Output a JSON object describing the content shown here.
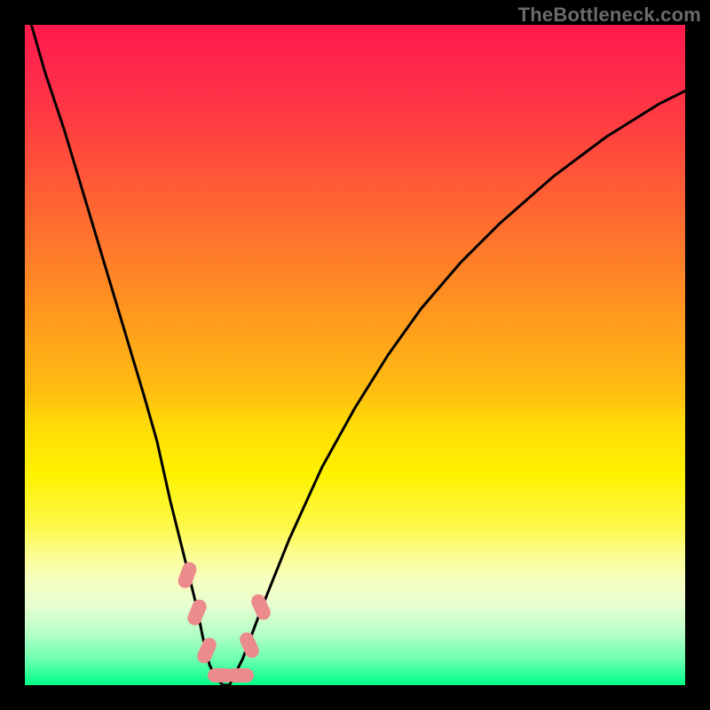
{
  "watermark": "TheBottleneck.com",
  "colors": {
    "frame": "#000000",
    "curve": "#000000",
    "marker": "#ec8b8b"
  },
  "chart_data": {
    "type": "line",
    "title": "",
    "xlabel": "",
    "ylabel": "",
    "xlim": [
      0,
      100
    ],
    "ylim": [
      0,
      100
    ],
    "series": [
      {
        "name": "bottleneck-curve",
        "x": [
          1,
          3,
          6,
          9,
          12,
          15,
          18,
          20,
          22,
          24,
          26,
          27,
          28,
          29,
          30,
          31,
          33,
          36,
          40,
          45,
          50,
          55,
          60,
          66,
          72,
          80,
          88,
          96,
          100
        ],
        "y": [
          100,
          93,
          84,
          74,
          64,
          54,
          44,
          37,
          28,
          20,
          12,
          7,
          3,
          1,
          0,
          0,
          4,
          12,
          22,
          33,
          42,
          50,
          57,
          64,
          70,
          77,
          83,
          88,
          90
        ]
      }
    ],
    "markers": [
      {
        "x": 24.5,
        "y": 16.5,
        "shape": "tilted-pill"
      },
      {
        "x": 25.8,
        "y": 10.5,
        "shape": "tilted-pill"
      },
      {
        "x": 27.2,
        "y": 4.5,
        "shape": "tilted-pill"
      },
      {
        "x": 29.2,
        "y": 0.0,
        "shape": "horizontal-pill"
      },
      {
        "x": 31.4,
        "y": 0.0,
        "shape": "horizontal-pill"
      },
      {
        "x": 33.3,
        "y": 6.0,
        "shape": "tilted-pill-right"
      },
      {
        "x": 35.0,
        "y": 12.0,
        "shape": "tilted-pill-right"
      }
    ],
    "notes": "V-shaped curve over a vertical rainbow gradient; minimum (best match) near x≈29–31. Axis values are estimated from pixel positions; chart carries no tick labels."
  }
}
